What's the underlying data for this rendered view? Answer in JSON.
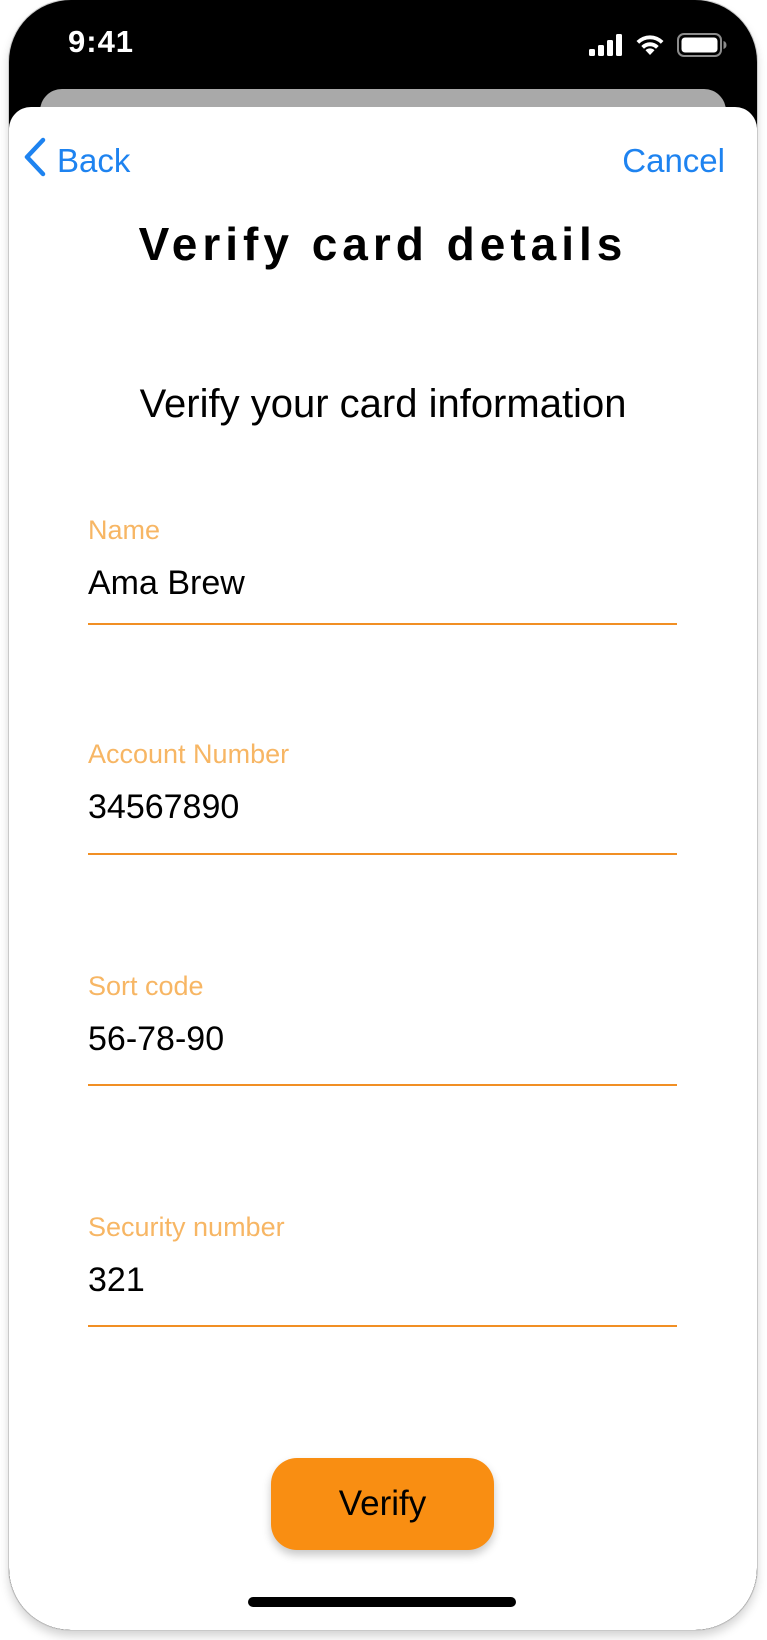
{
  "status_bar": {
    "time": "9:41",
    "icons": [
      "cellular-signal-icon",
      "wifi-icon",
      "battery-icon"
    ]
  },
  "nav": {
    "back_label": "Back",
    "back_icon": "chevron-left-icon",
    "cancel_label": "Cancel"
  },
  "page": {
    "title": "Verify card details",
    "subtitle": "Verify your card information"
  },
  "form": {
    "fields": [
      {
        "label": "Name",
        "value": "Ama Brew"
      },
      {
        "label": "Account Number",
        "value": "34567890"
      },
      {
        "label": "Sort code",
        "value": "56-78-90"
      },
      {
        "label": "Security number",
        "value": "321"
      }
    ]
  },
  "actions": {
    "verify_label": "Verify"
  },
  "colors": {
    "link": "#1e83f0",
    "field_label": "#f7b664",
    "underline": "#f18f24",
    "primary_button": "#f98e12"
  }
}
